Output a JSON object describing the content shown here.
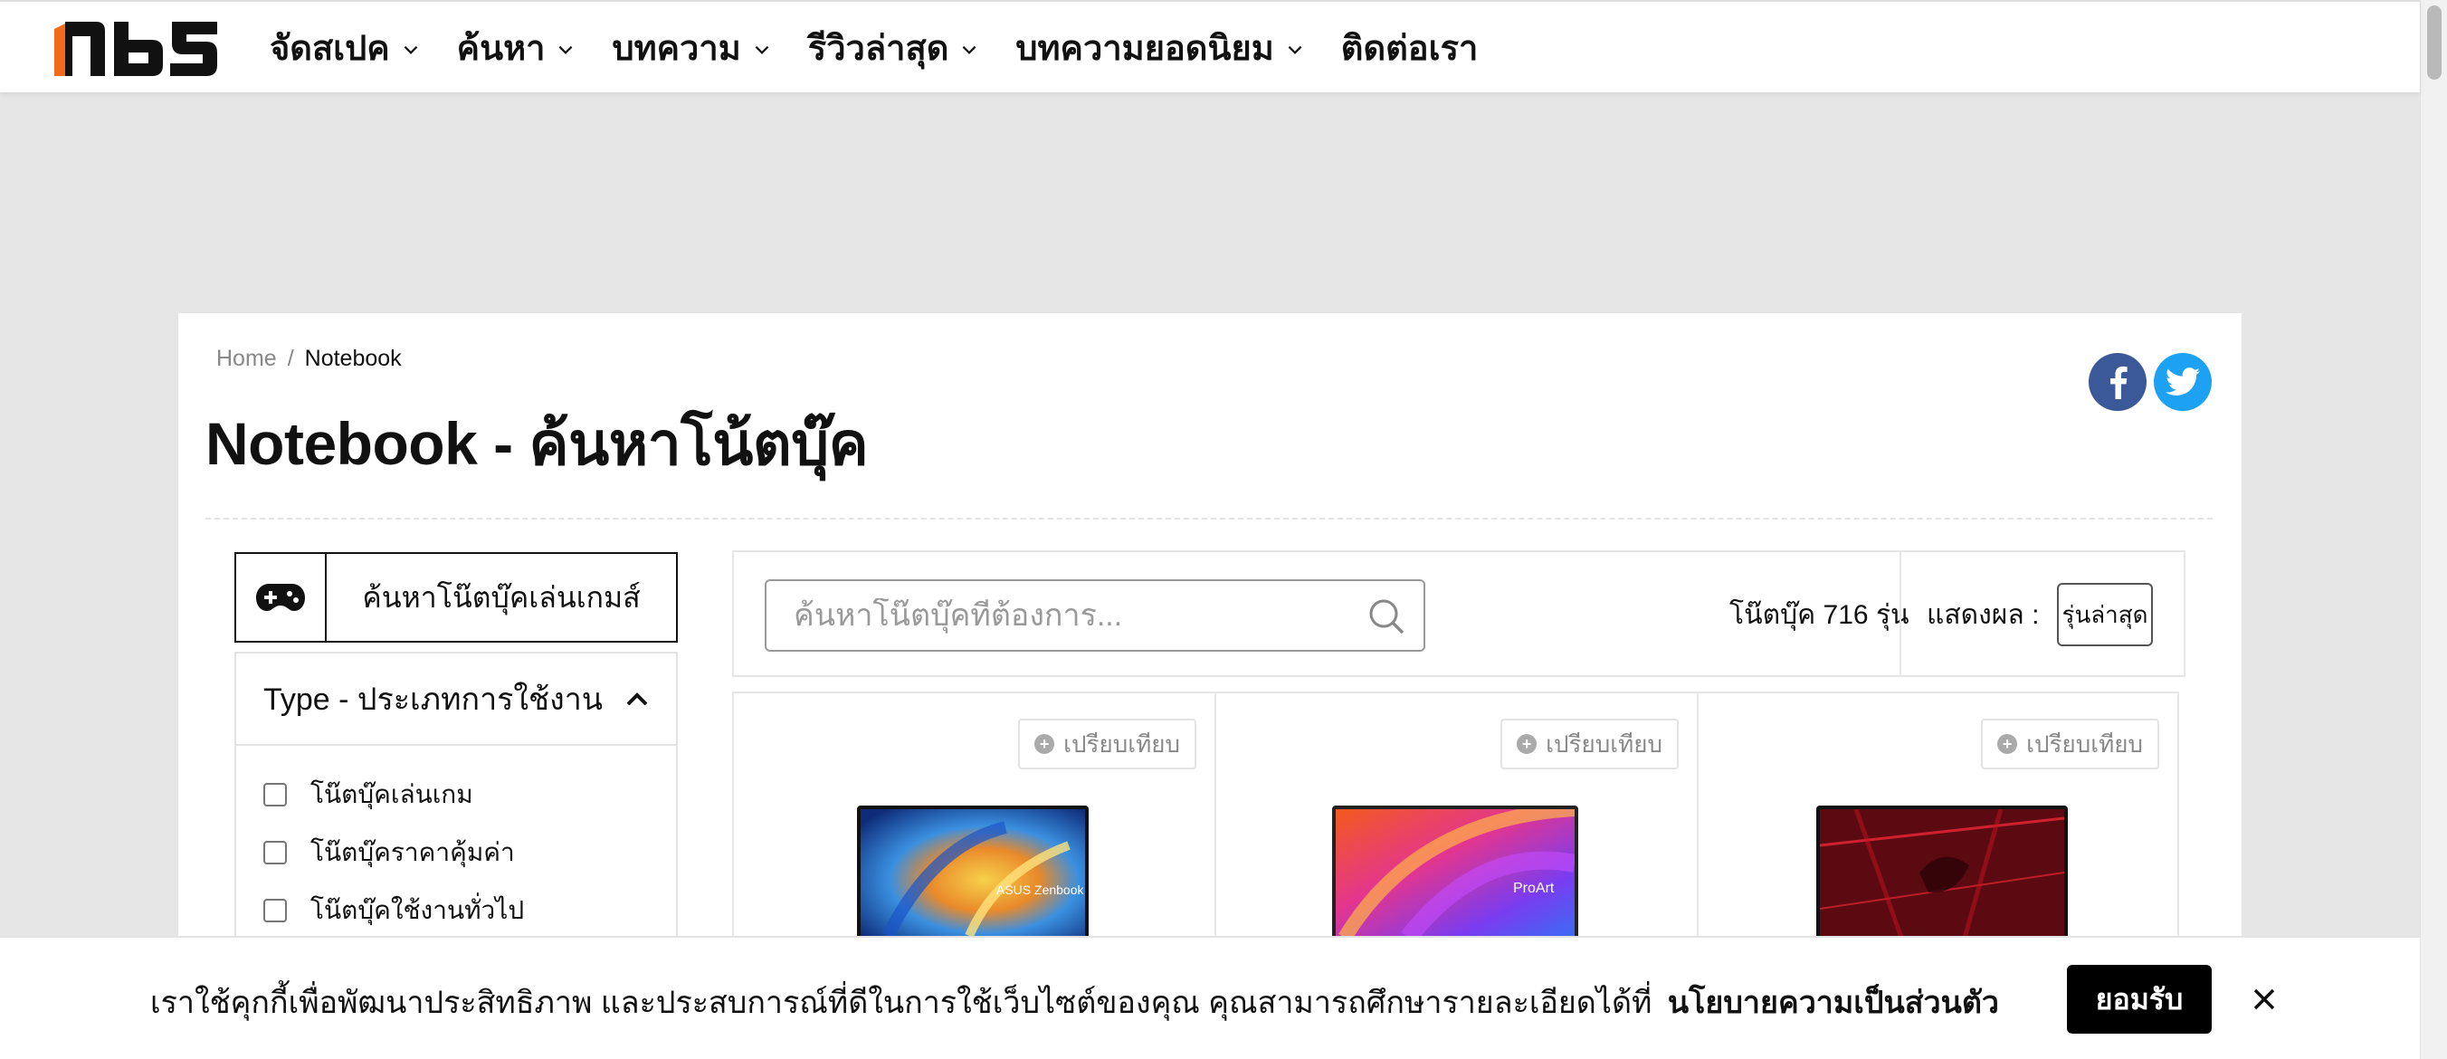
{
  "brand": {
    "logo_text": "nbs"
  },
  "nav": {
    "items": [
      {
        "label": "จัดสเปค",
        "has_dropdown": true
      },
      {
        "label": "ค้นหา",
        "has_dropdown": true
      },
      {
        "label": "บทความ",
        "has_dropdown": true
      },
      {
        "label": "รีวิวล่าสุด",
        "has_dropdown": true
      },
      {
        "label": "บทความยอดนิยม",
        "has_dropdown": true
      },
      {
        "label": "ติดต่อเรา",
        "has_dropdown": false
      }
    ]
  },
  "breadcrumb": {
    "home": "Home",
    "separator": "/",
    "current": "Notebook"
  },
  "page": {
    "title": "Notebook - ค้นหาโน้ตบุ๊ค"
  },
  "social": {
    "facebook_icon": "facebook-icon",
    "twitter_icon": "twitter-icon",
    "facebook_color": "#3b5998",
    "twitter_color": "#1da1f2"
  },
  "sidebar": {
    "game_button_label": "ค้นหาโน๊ตบุ๊คเล่นเกมส์",
    "filter": {
      "title": "Type - ประเภทการใช้งาน",
      "options": [
        "โน๊ตบุ๊คเล่นเกม",
        "โน๊ตบุ๊คราคาคุ้มค่า",
        "โน๊ตบุ๊คใช้งานทั่วไป"
      ]
    }
  },
  "toolbar": {
    "search_placeholder": "ค้นหาโน๊ตบุ๊คที่ต้องการ...",
    "count_label": "โน๊ตบุ๊ค 716 รุ่น",
    "sort_label": "แสดงผล :",
    "sort_value": "รุ่นล่าสุด"
  },
  "products": [
    {
      "compare_label": "เปรียบเทียบ",
      "screen_text": "ASUS Zenbook"
    },
    {
      "compare_label": "เปรียบเทียบ",
      "screen_text": "ProArt"
    },
    {
      "compare_label": "เปรียบเทียบ",
      "screen_text": ""
    }
  ],
  "cookie": {
    "text": "เราใช้คุกกี้เพื่อพัฒนาประสิทธิภาพ และประสบการณ์ที่ดีในการใช้เว็บไซต์ของคุณ คุณสามารถศึกษารายละเอียดได้ที่",
    "policy_link": "นโยบายความเป็นส่วนตัว",
    "accept_label": "ยอมรับ"
  }
}
